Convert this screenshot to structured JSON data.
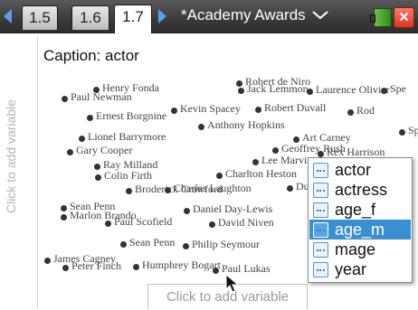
{
  "topbar": {
    "tabs": [
      {
        "label": "1.5",
        "active": false
      },
      {
        "label": "1.6",
        "active": false
      },
      {
        "label": "1.7",
        "active": true
      }
    ],
    "document_title": "*Academy Awards",
    "colors": {
      "nav_arrow": "#5aa0e8",
      "close": "#e0331f",
      "battery": "#4aa82c"
    }
  },
  "caption": "Caption: actor",
  "side_axis_hint": "Click to add variable",
  "bottom_axis_hint": "Click to add variable",
  "plot_points": [
    {
      "label": "Robert de Niro"
    },
    {
      "label": "Henry Fonda"
    },
    {
      "label": "Jack Lemmon"
    },
    {
      "label": "Laurence Olivier"
    },
    {
      "label": "Spe"
    },
    {
      "label": "Paul Newman"
    },
    {
      "label": "Rod"
    },
    {
      "label": "Ernest Borgnine"
    },
    {
      "label": "Kevin Spacey"
    },
    {
      "label": "Robert Duvall"
    },
    {
      "label": "Anthony Hopkins"
    },
    {
      "label": "Lionel Barrymore"
    },
    {
      "label": "Art Carney"
    },
    {
      "label": "Sp"
    },
    {
      "label": "Gary Cooper"
    },
    {
      "label": "Geoffrey Rush"
    },
    {
      "label": "Rex Harrison"
    },
    {
      "label": "Lee Marvin"
    },
    {
      "label": "Ray Milland"
    },
    {
      "label": "Colin Firth"
    },
    {
      "label": "Charlton Heston"
    },
    {
      "label": "Broderick Crawford"
    },
    {
      "label": "Charles Laughton"
    },
    {
      "label": "Dusti"
    },
    {
      "label": "Sean Penn"
    },
    {
      "label": "Marlon Brando"
    },
    {
      "label": "Daniel Day-Lewis"
    },
    {
      "label": "Paul Scofield"
    },
    {
      "label": "David Niven"
    },
    {
      "label": "Sean Penn"
    },
    {
      "label": "Philip Seymour"
    },
    {
      "label": "James Cagney"
    },
    {
      "label": "Peter Finch"
    },
    {
      "label": "Humphrey Bogart"
    },
    {
      "label": "Paul Lukas"
    }
  ],
  "variable_menu": {
    "items": [
      {
        "label": "actor",
        "selected": false
      },
      {
        "label": "actress",
        "selected": false
      },
      {
        "label": "age_f",
        "selected": false
      },
      {
        "label": "age_m",
        "selected": true
      },
      {
        "label": "mage",
        "selected": false
      },
      {
        "label": "year",
        "selected": false
      }
    ],
    "highlight_color": "#3a8fd0"
  }
}
